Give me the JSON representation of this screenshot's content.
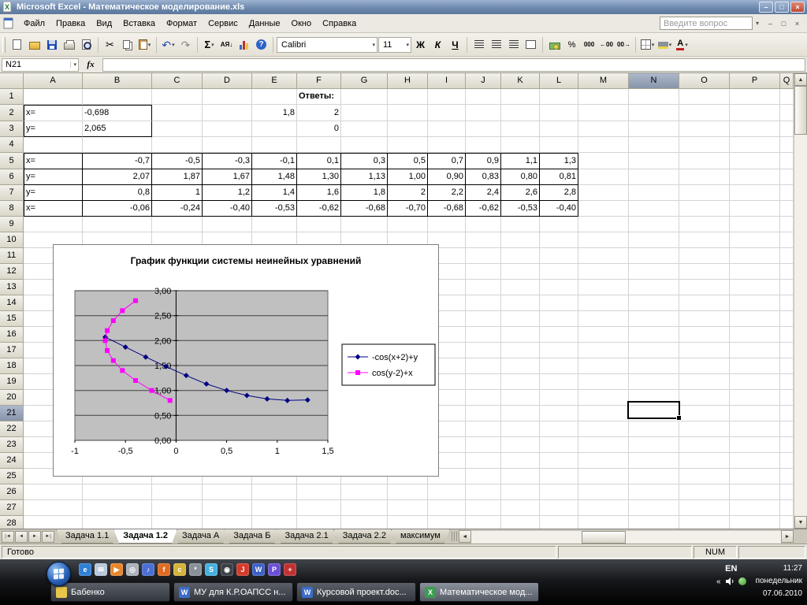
{
  "window": {
    "title": "Microsoft Excel - Математическое моделирование.xls"
  },
  "menu": {
    "items": [
      "Файл",
      "Правка",
      "Вид",
      "Вставка",
      "Формат",
      "Сервис",
      "Данные",
      "Окно",
      "Справка"
    ],
    "question_placeholder": "Введите вопрос"
  },
  "toolbar": {
    "font_name": "Calibri",
    "font_size": "11",
    "bold_label": "Ж",
    "italic_label": "К",
    "underline_label": "Ч",
    "sum_label": "Σ",
    "sort_label": "АЯ↓",
    "help_label": "?",
    "percent_label": "%",
    "thousands_label": "000",
    "inc_decimal_label": "←00",
    "dec_decimal_label": "00→"
  },
  "formula_bar": {
    "name_box": "N21",
    "fx_label": "fx",
    "formula_value": ""
  },
  "icons": {
    "cut": "✂",
    "undo": "↶",
    "redo": "↷",
    "dropdown": "▾",
    "min": "–",
    "max": "□",
    "close": "×",
    "up": "▲",
    "down": "▼",
    "left": "◄",
    "right": "►",
    "tab_first": "|◄",
    "tab_prev": "◄",
    "tab_next": "►",
    "tab_last": "►|",
    "chevron": "«",
    "font_color": "А"
  },
  "sheet": {
    "columns": [
      "A",
      "B",
      "C",
      "D",
      "E",
      "F",
      "G",
      "H",
      "I",
      "J",
      "K",
      "L",
      "M",
      "N",
      "O",
      "P"
    ],
    "row_count": 28,
    "selected": {
      "col": "N",
      "row": 21
    },
    "cells": {
      "1": {
        "F": "Ответы:"
      },
      "2": {
        "A": "x=",
        "B": "-0,698",
        "E": "1,8",
        "F": "2"
      },
      "3": {
        "A": "y=",
        "B": "2,065",
        "F": "0"
      },
      "5": {
        "A": "x=",
        "B": "-0,7",
        "C": "-0,5",
        "D": "-0,3",
        "E": "-0,1",
        "F": "0,1",
        "G": "0,3",
        "H": "0,5",
        "I": "0,7",
        "J": "0,9",
        "K": "1,1",
        "L": "1,3"
      },
      "6": {
        "A": "y=",
        "B": "2,07",
        "C": "1,87",
        "D": "1,67",
        "E": "1,48",
        "F": "1,30",
        "G": "1,13",
        "H": "1,00",
        "I": "0,90",
        "J": "0,83",
        "K": "0,80",
        "L": "0,81"
      },
      "7": {
        "A": "y=",
        "B": "0,8",
        "C": "1",
        "D": "1,2",
        "E": "1,4",
        "F": "1,6",
        "G": "1,8",
        "H": "2",
        "I": "2,2",
        "J": "2,4",
        "K": "2,6",
        "L": "2,8"
      },
      "8": {
        "A": "x=",
        "B": "-0,06",
        "C": "-0,24",
        "D": "-0,40",
        "E": "-0,53",
        "F": "-0,62",
        "G": "-0,68",
        "H": "-0,70",
        "I": "-0,68",
        "J": "-0,62",
        "K": "-0,53",
        "L": "-0,40"
      }
    }
  },
  "chart_data": {
    "type": "scatter",
    "title": "График функции системы неинейных уравнений",
    "xlim": [
      -1,
      1.5
    ],
    "ylim": [
      0,
      3
    ],
    "x_ticks": [
      -1,
      -0.5,
      0,
      0.5,
      1,
      1.5
    ],
    "x_tick_labels": [
      "-1",
      "-0,5",
      "0",
      "0,5",
      "1",
      "1,5"
    ],
    "y_ticks": [
      0,
      0.5,
      1,
      1.5,
      2,
      2.5,
      3
    ],
    "y_tick_labels": [
      "0,00",
      "0,50",
      "1,00",
      "1,50",
      "2,00",
      "2,50",
      "3,00"
    ],
    "grid": "horizontal",
    "plot_bg": "#c0c0c0",
    "legend_position": "right",
    "series": [
      {
        "name": "-cos(x+2)+y",
        "color": "#000080",
        "marker": "diamond",
        "x": [
          -0.7,
          -0.5,
          -0.3,
          -0.1,
          0.1,
          0.3,
          0.5,
          0.7,
          0.9,
          1.1,
          1.3
        ],
        "y": [
          2.07,
          1.87,
          1.67,
          1.48,
          1.3,
          1.13,
          1.0,
          0.9,
          0.83,
          0.8,
          0.81
        ]
      },
      {
        "name": "cos(y-2)+x",
        "color": "#ff00ff",
        "marker": "square",
        "x": [
          -0.06,
          -0.24,
          -0.4,
          -0.53,
          -0.62,
          -0.68,
          -0.7,
          -0.68,
          -0.62,
          -0.53,
          -0.4
        ],
        "y": [
          0.8,
          1.0,
          1.2,
          1.4,
          1.6,
          1.8,
          2.0,
          2.2,
          2.4,
          2.6,
          2.8
        ]
      }
    ]
  },
  "tabs": {
    "items": [
      "Задача 1.1",
      "Задача 1.2",
      "Задача А",
      "Задача Б",
      "Задача 2.1",
      "Задача 2.2",
      "максимум"
    ],
    "active": "Задача 1.2"
  },
  "status": {
    "ready": "Готово",
    "num": "NUM"
  },
  "taskbar": {
    "quick_launch": [
      {
        "name": "internet-explorer-icon",
        "color": "#2f7fd6",
        "glyph": "e"
      },
      {
        "name": "mail-icon",
        "color": "#b8c8dc",
        "glyph": "✉"
      },
      {
        "name": "media-player-icon",
        "color": "#e8862a",
        "glyph": "▶"
      },
      {
        "name": "dvd-icon",
        "color": "#aab0b8",
        "glyph": "◎"
      },
      {
        "name": "winamp-icon",
        "color": "#4a6fd4",
        "glyph": "♪"
      },
      {
        "name": "firefox-icon",
        "color": "#e06a1f",
        "glyph": "f"
      },
      {
        "name": "chrome-icon",
        "color": "#d4b33a",
        "glyph": "c"
      },
      {
        "name": "settings-icon",
        "color": "#8a9098",
        "glyph": "*"
      },
      {
        "name": "skype-icon",
        "color": "#45b0e0",
        "glyph": "S"
      },
      {
        "name": "camera-icon",
        "color": "#3a3f46",
        "glyph": "◉"
      },
      {
        "name": "jpg-icon",
        "color": "#d43a2a",
        "glyph": "J"
      },
      {
        "name": "word-icon",
        "color": "#3b5fc7",
        "glyph": "W"
      },
      {
        "name": "photoshop-icon",
        "color": "#6a4fd4",
        "glyph": "P"
      },
      {
        "name": "antivirus-icon",
        "color": "#c03030",
        "glyph": "+"
      }
    ],
    "windows": [
      {
        "label": "Бабенко",
        "icon": "folder-icon",
        "active": false
      },
      {
        "label": "МУ для К.Р.ОАПСС н...",
        "icon": "word-icon",
        "active": false
      },
      {
        "label": "Курсовой проект.doc...",
        "icon": "word-icon",
        "active": false
      },
      {
        "label": "Математическое мод...",
        "icon": "excel-icon",
        "active": true
      }
    ],
    "tray": {
      "lang": "EN",
      "time": "11:27",
      "weekday": "понедельник",
      "date": "07.06.2010"
    }
  }
}
